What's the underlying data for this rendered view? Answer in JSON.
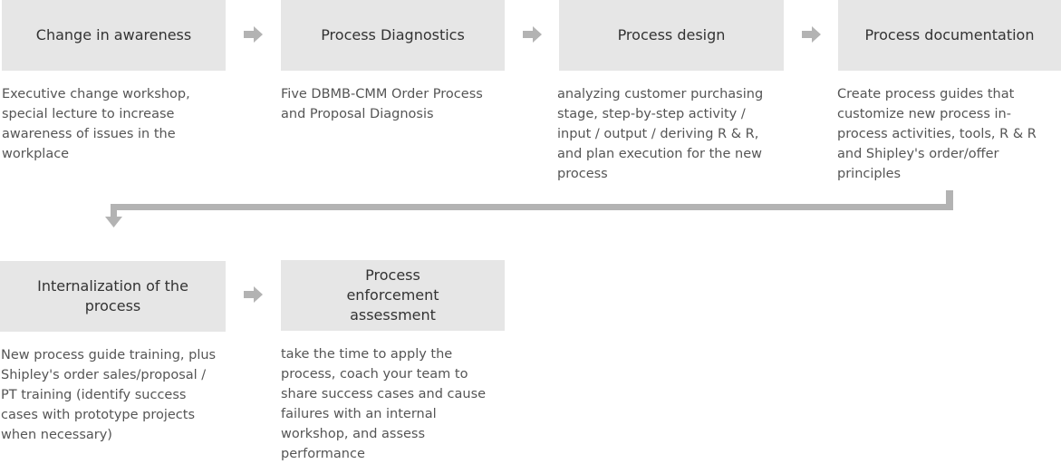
{
  "steps": [
    {
      "title": "Change in awareness",
      "description": "Executive change workshop, special lecture to increase awareness of issues in the workplace"
    },
    {
      "title": "Process Diagnostics",
      "description": "Five DBMB-CMM Order Process and Proposal Diagnosis"
    },
    {
      "title": "Process design",
      "description": "analyzing customer purchasing stage, step-by-step activity / input / output / deriving R & R, and plan execution for the new process"
    },
    {
      "title": "Process documentation",
      "description": "Create process guides that customize new process in-process activities, tools, R & R and Shipley's order/offer principles"
    },
    {
      "title": "Internalization of the process",
      "description": "New process guide training, plus Shipley's order sales/proposal / PT training (identify success cases with prototype projects when necessary)"
    },
    {
      "title": "Process enforcement assessment",
      "description": "take the time to apply the process, coach your team to share success cases and cause failures with an internal workshop, and assess performance"
    }
  ],
  "colors": {
    "box": "#e6e6e6",
    "arrow": "#b3b3b3",
    "connector": "#b3b3b3"
  }
}
